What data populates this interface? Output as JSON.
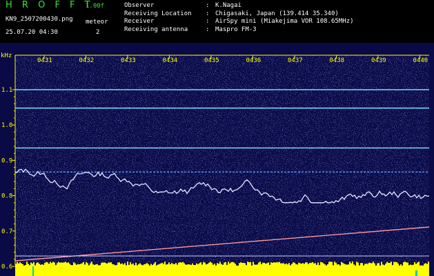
{
  "header": {
    "app_title": "H R O F F T",
    "version": "1.00f",
    "filename": "KN9_2507200430.png",
    "datetime": "25.07.20 04:30",
    "meteor_label": "meteor",
    "meteor_count": "2",
    "meta": [
      {
        "key": "Observer",
        "sep": ":",
        "value": "K.Nagai"
      },
      {
        "key": "Receiving Location",
        "sep": ":",
        "value": "Chigasaki, Japan (139.414 35.340)"
      },
      {
        "key": "Receiver",
        "sep": ":",
        "value": "AirSpy mini (Miakejima VOR 108.65MHz)"
      },
      {
        "key": "Receiving antenna",
        "sep": ":",
        "value": "Maspro FM-3"
      }
    ]
  },
  "plot": {
    "unit_label": "kHz",
    "time_ticks": [
      "0431",
      "0432",
      "0433",
      "0434",
      "0435",
      "0436",
      "0437",
      "0438",
      "0439",
      "0440"
    ],
    "freq_ticks": [
      "1.1",
      "1.0",
      "0.9",
      "0.8",
      "0.7",
      "0.6"
    ],
    "colors": {
      "background": "#0a0a40",
      "axis": "#ffff00",
      "tick_text": "#ffff00",
      "trace": "#e0e0ff",
      "line": "#7ad0ff"
    }
  }
}
